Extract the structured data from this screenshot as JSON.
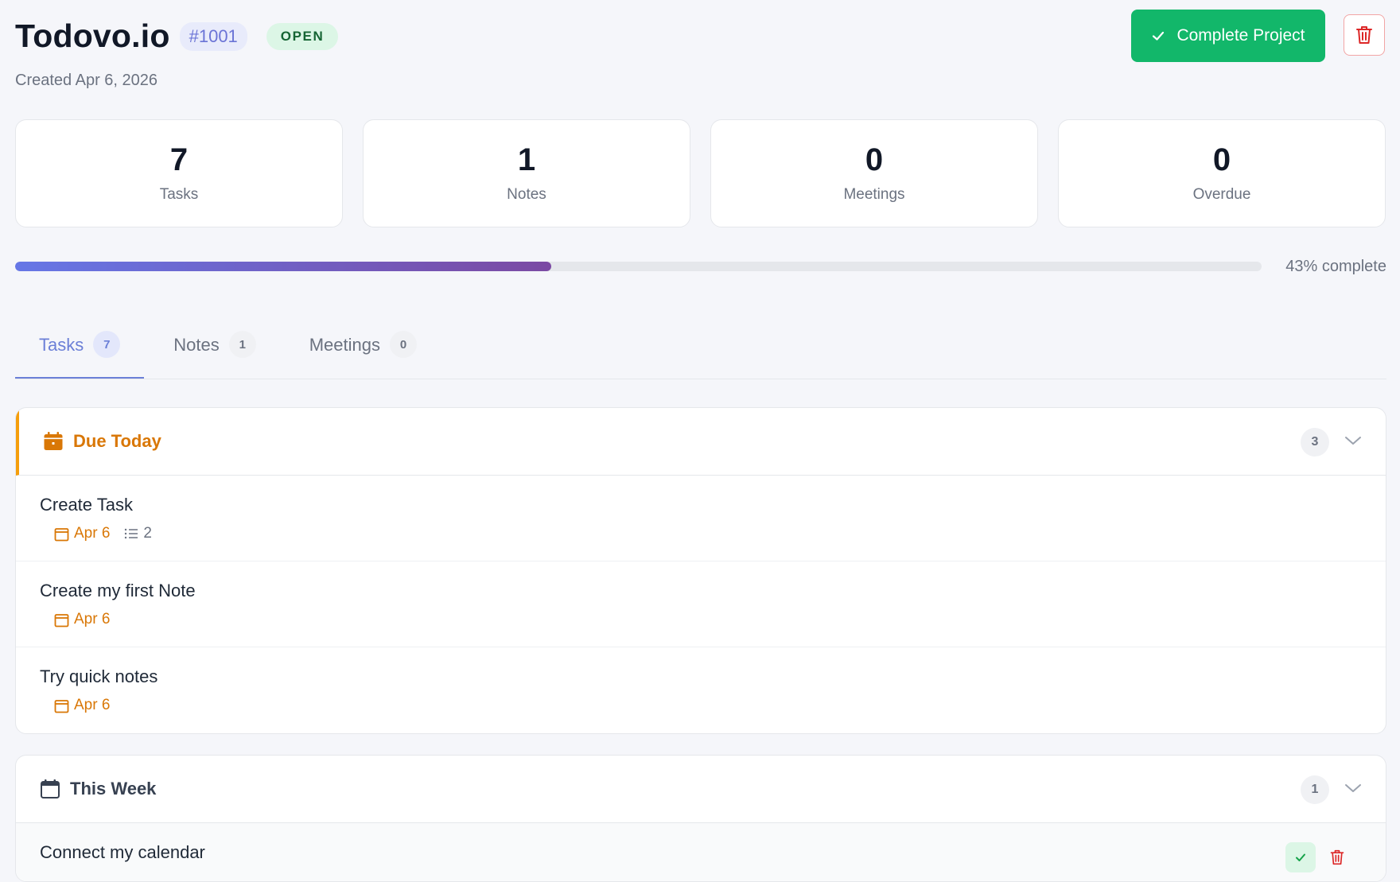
{
  "project": {
    "title": "Todovo.io",
    "id": "#1001",
    "status": "OPEN",
    "created": "Created Apr 6, 2026",
    "complete_label": "Complete Project"
  },
  "stats": [
    {
      "value": "7",
      "label": "Tasks"
    },
    {
      "value": "1",
      "label": "Notes"
    },
    {
      "value": "0",
      "label": "Meetings"
    },
    {
      "value": "0",
      "label": "Overdue"
    }
  ],
  "progress": {
    "percent": 43,
    "label": "43% complete"
  },
  "tabs": [
    {
      "label": "Tasks",
      "count": "7",
      "active": true
    },
    {
      "label": "Notes",
      "count": "1",
      "active": false
    },
    {
      "label": "Meetings",
      "count": "0",
      "active": false
    }
  ],
  "sections": {
    "due_today": {
      "title": "Due Today",
      "count": "3",
      "tasks": [
        {
          "title": "Create Task",
          "date": "Apr 6",
          "subtasks": "2"
        },
        {
          "title": "Create my first Note",
          "date": "Apr 6"
        },
        {
          "title": "Try quick notes",
          "date": "Apr 6"
        }
      ]
    },
    "this_week": {
      "title": "This Week",
      "count": "1",
      "tasks": [
        {
          "title": "Connect my calendar"
        }
      ]
    }
  },
  "colors": {
    "accent": "#6b7fd7",
    "success": "#12b76a",
    "warning": "#d97706",
    "danger": "#dc2626"
  }
}
